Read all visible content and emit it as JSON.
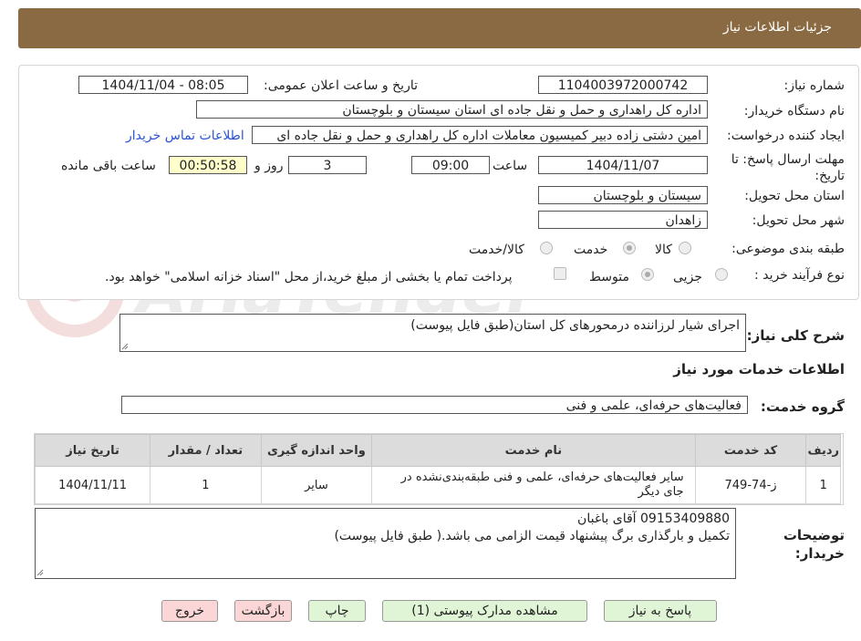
{
  "header": {
    "title": "جزئیات اطلاعات نیاز"
  },
  "fields": {
    "need_number_label": "شماره نیاز:",
    "need_number": "1104003972000742",
    "announce_label": "تاریخ و ساعت اعلان عمومی:",
    "announce_value": "1404/11/04 - 08:05",
    "buyer_label": "نام دستگاه خریدار:",
    "buyer_value": "اداره کل راهداری و حمل و نقل جاده ای استان سیستان و بلوچستان",
    "creator_label": "ایجاد کننده درخواست:",
    "creator_value": "امین دشتی زاده دبیر کمیسیون معاملات اداره کل راهداری و حمل و نقل جاده ای",
    "contact_link": "اطلاعات تماس خریدار",
    "deadline_label": "مهلت ارسال پاسخ: تا تاریخ:",
    "deadline_date": "1404/11/07",
    "time_label": "ساعت",
    "deadline_time": "09:00",
    "days_value": "3",
    "days_label": "روز و",
    "remaining_value": "00:50:58",
    "remaining_label": "ساعت باقی مانده",
    "province_label": "استان محل تحویل:",
    "province_value": "سیستان و بلوچستان",
    "city_label": "شهر محل تحویل:",
    "city_value": "زاهدان",
    "category_label": "طبقه بندی موضوعی:",
    "category_options": [
      "کالا",
      "خدمت",
      "کالا/خدمت"
    ],
    "category_selected": "خدمت",
    "process_label": "نوع فرآیند خرید :",
    "process_options": [
      "جزیی",
      "متوسط"
    ],
    "process_selected": "متوسط",
    "payment_note": "پرداخت تمام یا بخشی از مبلغ خرید،از محل \"اسناد خزانه اسلامی\" خواهد بود."
  },
  "summary": {
    "label": "شرح کلی نیاز:",
    "value": "اجرای شیار لرزاننده درمحورهای کل استان(طبق فایل پیوست)"
  },
  "services": {
    "section_title": "اطلاعات خدمات مورد نیاز",
    "group_label": "گروه خدمت:",
    "group_value": "فعالیت‌های حرفه‌ای، علمی و فنی",
    "columns": [
      "ردیف",
      "کد خدمت",
      "نام خدمت",
      "واحد اندازه گیری",
      "تعداد / مقدار",
      "تاریخ نیاز"
    ],
    "rows": [
      [
        "1",
        "ز-74-749",
        "سایر فعالیت‌های حرفه‌ای، علمی و فنی طبقه‌بندی‌نشده در جای دیگر",
        "سایر",
        "1",
        "1404/11/11"
      ]
    ]
  },
  "buyer_notes": {
    "label": "توضیحات خریدار:",
    "line1": "09153409880 آقای باغبان",
    "line2": "تکمیل و بارگذاری برگ پیشنهاد قیمت الزامی می باشد.( طبق فایل پیوست)"
  },
  "buttons": {
    "reply": "پاسخ به نیاز",
    "attachments": "مشاهده مدارک پیوستی (1)",
    "print": "چاپ",
    "back": "بازگشت",
    "exit": "خروج"
  },
  "watermark": {
    "text": "AriaTender.neT"
  },
  "colors": {
    "header": "#8a6a42",
    "link": "#2a54d6",
    "green_button": "#dff5d6",
    "pink_button": "#fbd6d6",
    "timer": "#ffffcc"
  }
}
